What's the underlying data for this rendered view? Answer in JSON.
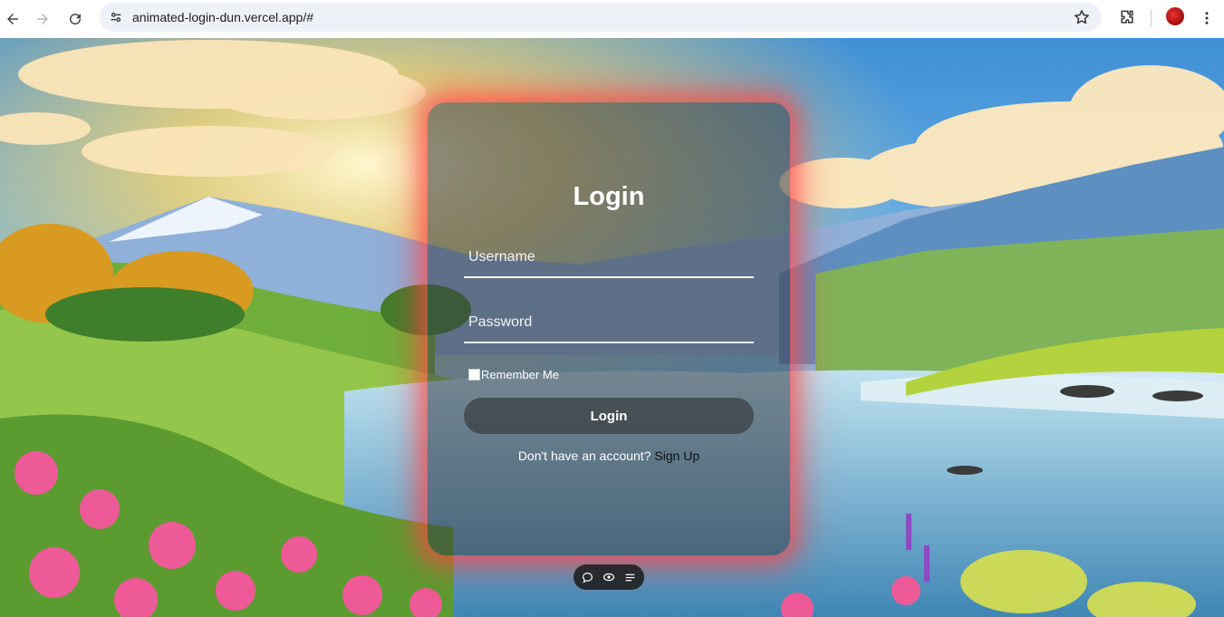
{
  "browser": {
    "url": "animated-login-dun.vercel.app/#",
    "back_icon": "arrow-left-icon",
    "forward_icon": "arrow-right-icon",
    "reload_icon": "reload-icon",
    "site_info_icon": "tune-icon",
    "bookmark_icon": "star-icon",
    "extensions_icon": "puzzle-icon",
    "menu_icon": "kebab-menu-icon"
  },
  "login": {
    "title": "Login",
    "username_placeholder": "Username",
    "password_placeholder": "Password",
    "remember_label": "Remember Me",
    "button_label": "Login",
    "signup_prompt": "Don't have an account?",
    "signup_link": "Sign Up"
  },
  "toolbar": {
    "icons": [
      "comment-icon",
      "eye-icon",
      "list-icon"
    ]
  },
  "colors": {
    "card_glow": "#ff4646",
    "text": "#ffffff",
    "link": "#111111"
  }
}
